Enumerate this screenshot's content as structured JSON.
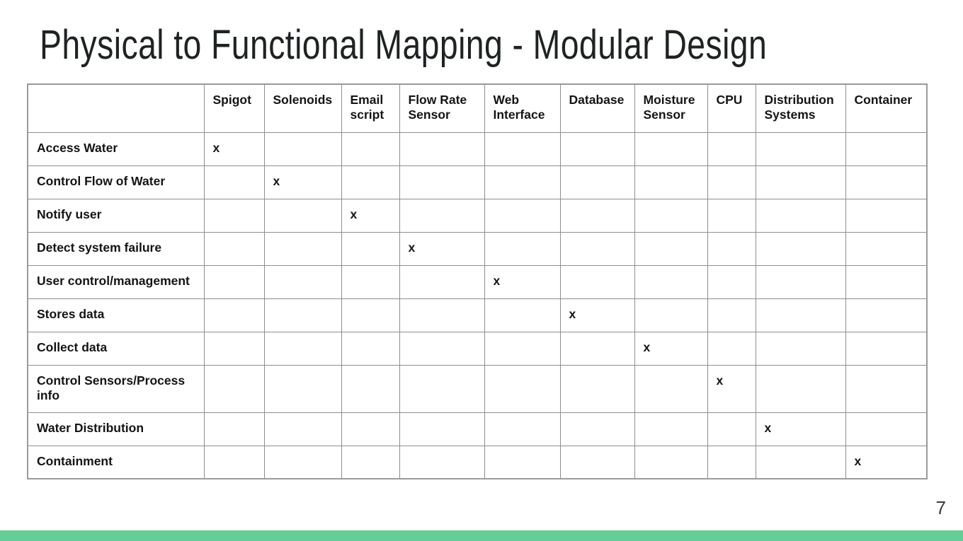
{
  "slide": {
    "title": "Physical to Functional Mapping - Modular Design",
    "page_number": "7",
    "accent_color": "#65ce96",
    "grid_line_color": "#8e8e8e",
    "outer_border_color": "#9a9a9a",
    "text_color": "#141414",
    "title_color": "#1f2223",
    "background_color": "#ffffff"
  },
  "matrix": {
    "corner_label": "",
    "mark_symbol": "x",
    "columns": [
      "Spigot",
      "Solenoids",
      "Email script",
      "Flow Rate Sensor",
      "Web Interface",
      "Database",
      "Moisture Sensor",
      "CPU",
      "Distribution Systems",
      "Container"
    ],
    "rows": [
      {
        "label": "Access Water",
        "marks": [
          "x",
          "",
          "",
          "",
          "",
          "",
          "",
          "",
          "",
          ""
        ]
      },
      {
        "label": "Control Flow of Water",
        "marks": [
          "",
          "x",
          "",
          "",
          "",
          "",
          "",
          "",
          "",
          ""
        ]
      },
      {
        "label": "Notify user",
        "marks": [
          "",
          "",
          "x",
          "",
          "",
          "",
          "",
          "",
          "",
          ""
        ]
      },
      {
        "label": "Detect system failure",
        "marks": [
          "",
          "",
          "",
          "x",
          "",
          "",
          "",
          "",
          "",
          ""
        ]
      },
      {
        "label": "User control/management",
        "marks": [
          "",
          "",
          "",
          "",
          "x",
          "",
          "",
          "",
          "",
          ""
        ]
      },
      {
        "label": "Stores data",
        "marks": [
          "",
          "",
          "",
          "",
          "",
          "x",
          "",
          "",
          "",
          ""
        ]
      },
      {
        "label": "Collect data",
        "marks": [
          "",
          "",
          "",
          "",
          "",
          "",
          "x",
          "",
          "",
          ""
        ]
      },
      {
        "label": "Control Sensors/Process info",
        "marks": [
          "",
          "",
          "",
          "",
          "",
          "",
          "",
          "x",
          "",
          ""
        ]
      },
      {
        "label": "Water Distribution",
        "marks": [
          "",
          "",
          "",
          "",
          "",
          "",
          "",
          "",
          "x",
          ""
        ]
      },
      {
        "label": "Containment",
        "marks": [
          "",
          "",
          "",
          "",
          "",
          "",
          "",
          "",
          "",
          "x"
        ]
      }
    ]
  }
}
